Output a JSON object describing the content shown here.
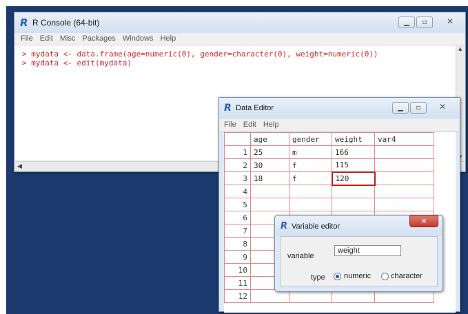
{
  "console": {
    "title": "R Console (64-bit)",
    "menu": [
      "File",
      "Edit",
      "Misc",
      "Packages",
      "Windows",
      "Help"
    ],
    "lines": [
      "> mydata <- data.frame(age=numeric(0), gender=character(0), weight=numeric(0))",
      "> mydata <- edit(mydata)"
    ]
  },
  "editor": {
    "title": "Data Editor",
    "menu": [
      "File",
      "Edit",
      "Help"
    ],
    "columns": [
      "age",
      "gender",
      "weight",
      "var4"
    ],
    "rows": [
      [
        "1",
        "25",
        "m",
        "166",
        ""
      ],
      [
        "2",
        "30",
        "f",
        "115",
        ""
      ],
      [
        "3",
        "18",
        "f",
        "120",
        ""
      ],
      [
        "4",
        "",
        "",
        "",
        ""
      ],
      [
        "5",
        "",
        "",
        "",
        ""
      ],
      [
        "6",
        "",
        "",
        "",
        ""
      ],
      [
        "7",
        "",
        "",
        "",
        ""
      ],
      [
        "8",
        "",
        "",
        "",
        ""
      ],
      [
        "9",
        "",
        "",
        "",
        ""
      ],
      [
        "10",
        "",
        "",
        "",
        ""
      ],
      [
        "11",
        "",
        "",
        "",
        ""
      ],
      [
        "12",
        "",
        "",
        "",
        ""
      ]
    ]
  },
  "variable_editor": {
    "title": "Variable editor",
    "variable_label": "variable",
    "variable_value": "weight",
    "type_label": "type",
    "type_options": [
      "numeric",
      "character"
    ],
    "selected_type": "numeric"
  },
  "icons": {
    "minimize": "minimize-icon",
    "maximize": "maximize-icon",
    "close": "close-icon",
    "r_logo": "r-logo-icon"
  }
}
